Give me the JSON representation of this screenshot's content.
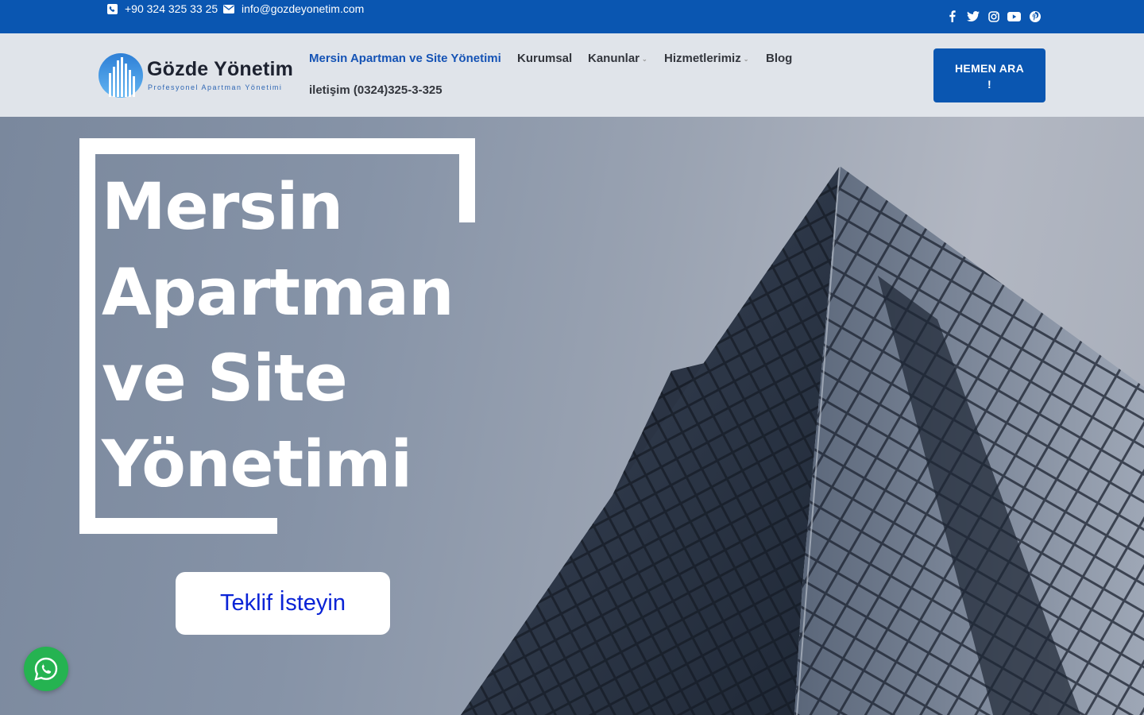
{
  "topbar": {
    "phone": "+90 324 325 33 25",
    "email": "info@gozdeyonetim.com",
    "phone_icon": "phone-icon",
    "email_icon": "envelope-icon",
    "socials": [
      "facebook-icon",
      "twitter-icon",
      "instagram-icon",
      "youtube-icon",
      "pinterest-icon"
    ]
  },
  "logo": {
    "name": "Gözde Yönetim",
    "tagline": "Profesyonel Apartman Yönetimi"
  },
  "nav": {
    "items": [
      {
        "label": "Mersin Apartman ve Site Yönetimi",
        "active": true
      },
      {
        "label": "Kurumsal"
      },
      {
        "label": "Kanunlar",
        "dropdown": true
      },
      {
        "label": "Hizmetlerimiz",
        "dropdown": true
      },
      {
        "label": "Blog"
      },
      {
        "label": "iletişim (0324)325-3-325"
      }
    ]
  },
  "cta": {
    "label_line1": "HEMEN ARA",
    "label_line2": "!"
  },
  "hero": {
    "title_lines": [
      "Mersin",
      "Apartman",
      "ve Site",
      "Yönetimi"
    ],
    "button": "Teklif İsteyin"
  },
  "colors": {
    "brand_blue": "#0a56b1",
    "whatsapp_green": "#25b351",
    "button_text": "#0a23d6"
  },
  "whatsapp": {
    "icon": "whatsapp-icon"
  }
}
